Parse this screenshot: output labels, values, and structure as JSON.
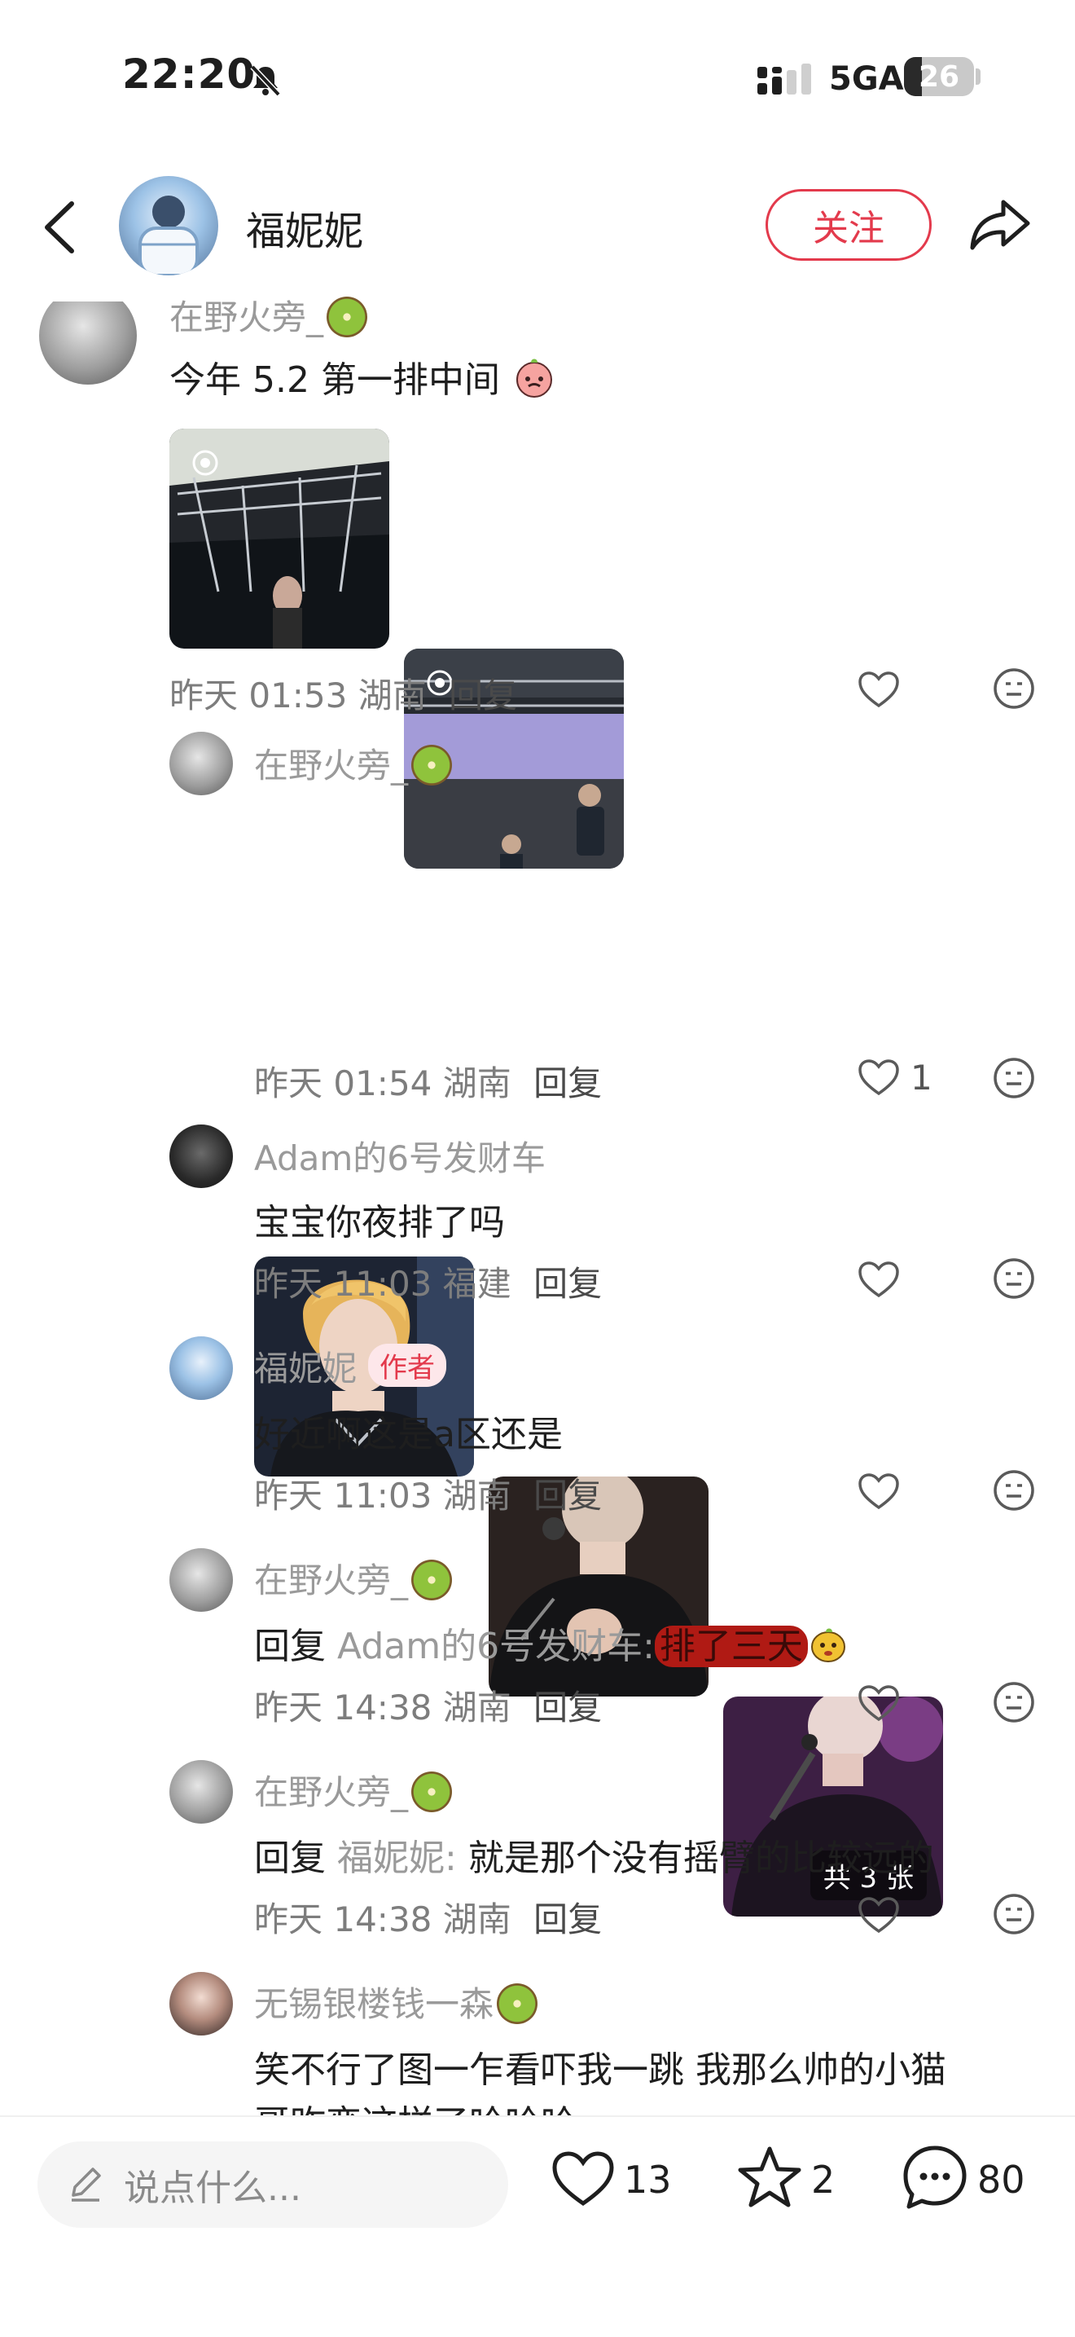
{
  "status_bar": {
    "time": "22:20",
    "network": "5GA",
    "battery": "26"
  },
  "header": {
    "username": "福妮妮",
    "follow_label": "关注"
  },
  "comments": [
    {
      "username": "在野火旁_",
      "text": "今年 5.2 第一排中间",
      "time": "昨天 01:53",
      "location": "湖南",
      "reply_label": "回复"
    },
    {
      "username": "在野火旁_",
      "image_count_label": "共 3 张",
      "time": "昨天 01:54",
      "location": "湖南",
      "reply_label": "回复",
      "likes": "1"
    },
    {
      "username": "Adam的6号发财车",
      "text": "宝宝你夜排了吗",
      "time": "昨天 11:03",
      "location": "福建",
      "reply_label": "回复"
    },
    {
      "username": "福妮妮",
      "badge": "作者",
      "text": "好近啊这是a区还是",
      "time": "昨天 11:03",
      "location": "湖南",
      "reply_label": "回复"
    },
    {
      "username": "在野火旁_",
      "reply_prefix": "回复",
      "reply_to": "Adam的6号发财车:",
      "text": "排了三天",
      "time": "昨天 14:38",
      "location": "湖南",
      "reply_label": "回复"
    },
    {
      "username": "在野火旁_",
      "reply_prefix": "回复",
      "reply_to": "福妮妮:",
      "text": "就是那个没有摇臂的比较远的",
      "time": "昨天 14:38",
      "location": "湖南",
      "reply_label": "回复"
    },
    {
      "username": "无锡银楼钱一森",
      "text": "笑不行了图一乍看吓我一跳 我那么帅的小猫",
      "text_line2": "哥昨变这样了哈哈哈"
    }
  ],
  "bottom_bar": {
    "input_placeholder": "说点什么...",
    "likes": "13",
    "favorites": "2",
    "comments": "80"
  },
  "colors": {
    "accent": "#e33a4c",
    "muted_text": "#9a9a9a",
    "highlight": "#b01a14"
  }
}
